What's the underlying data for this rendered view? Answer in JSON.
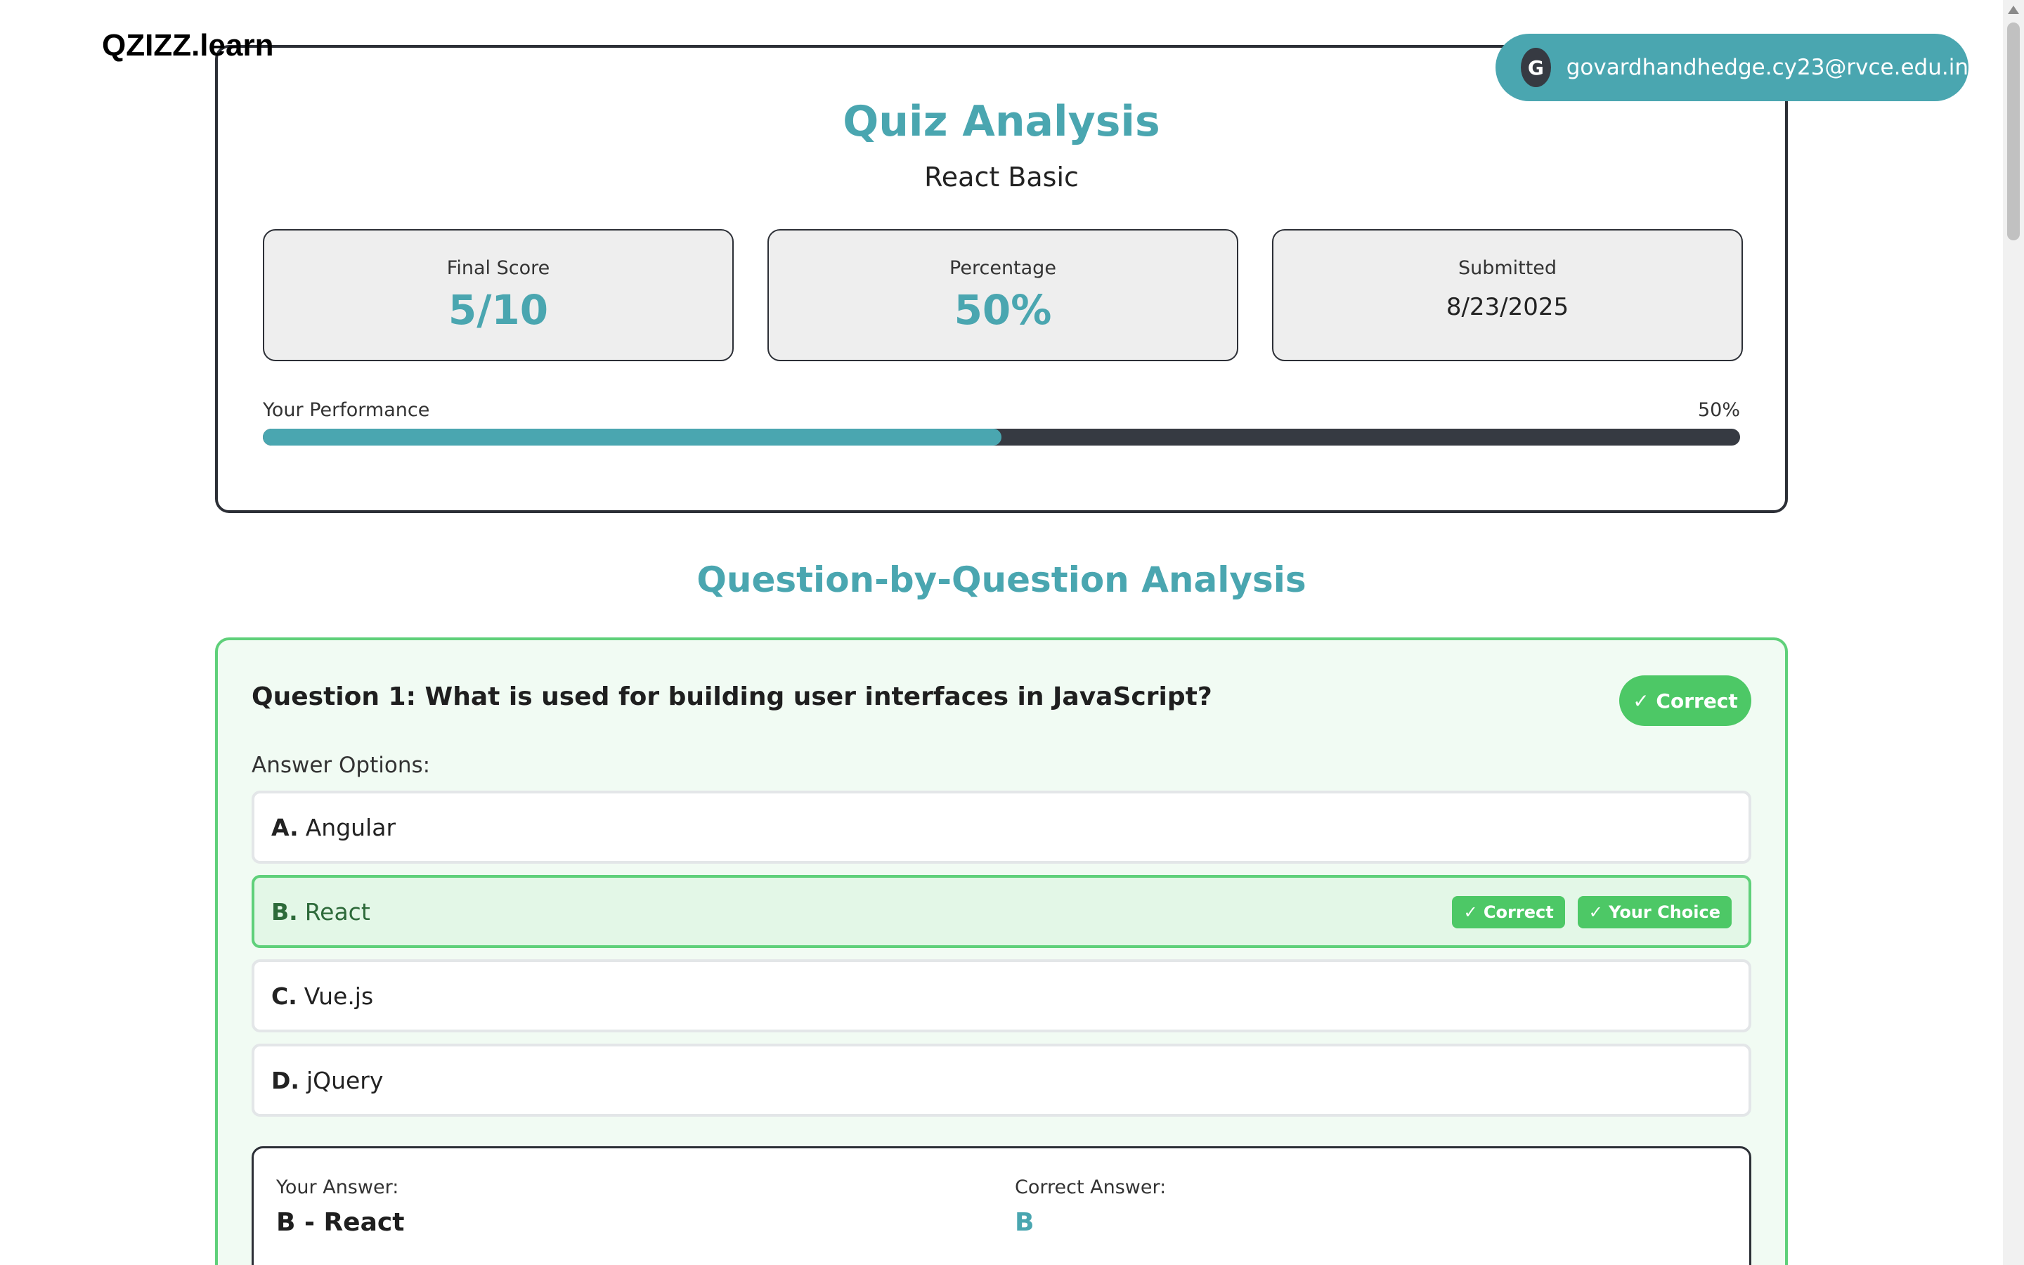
{
  "header": {
    "brand": "QZIZZ.learn",
    "user": {
      "avatar_initial": "G",
      "email": "govardhandhedge.cy23@rvce.edu.in"
    }
  },
  "summary": {
    "title": "Quiz Analysis",
    "subtitle": "React Basic",
    "stats": [
      {
        "label": "Final Score",
        "value": "5/10"
      },
      {
        "label": "Percentage",
        "value": "50%"
      },
      {
        "label": "Submitted",
        "value": "8/23/2025"
      }
    ],
    "performance": {
      "label": "Your Performance",
      "value_text": "50%",
      "fraction": 0.5
    }
  },
  "analysis": {
    "title": "Question-by-Question Analysis",
    "questions": [
      {
        "text": "Question 1: What is used for building user interfaces in JavaScript?",
        "status": "✓ Correct",
        "options_label": "Answer Options:",
        "options": [
          {
            "letter": "A.",
            "text": "Angular"
          },
          {
            "letter": "B.",
            "text": "React",
            "tag_correct": "✓ Correct",
            "tag_choice": "✓ Your Choice"
          },
          {
            "letter": "C.",
            "text": "Vue.js"
          },
          {
            "letter": "D.",
            "text": "jQuery"
          }
        ],
        "your_answer_label": "Your Answer:",
        "your_answer": "B - React",
        "correct_answer_label": "Correct Answer:",
        "correct_answer": "B"
      }
    ]
  },
  "colors": {
    "accent": "#4aa6b0",
    "success": "#4dc866",
    "dark": "#363a42"
  }
}
